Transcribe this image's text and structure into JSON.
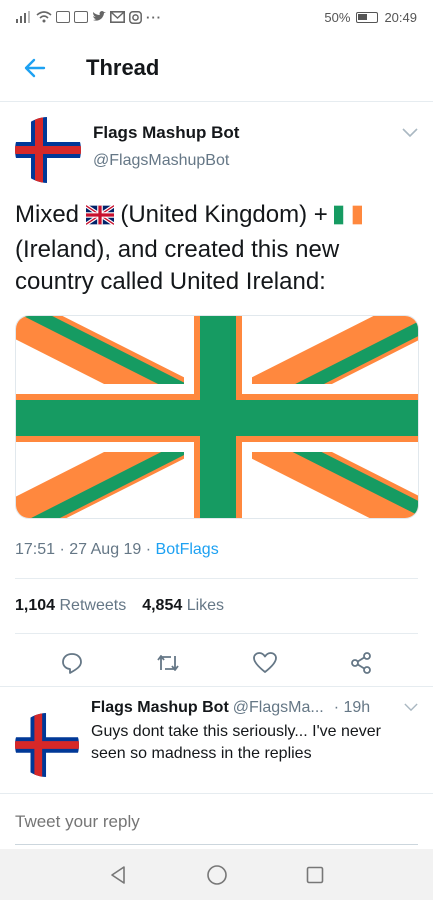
{
  "status_bar": {
    "battery_percent": "50%",
    "time": "20:49",
    "notification_icons": [
      "signal-icon",
      "wifi-icon",
      "facebook-icon",
      "photos-icon",
      "twitter-icon",
      "mail-icon",
      "instagram-icon",
      "more-icon"
    ],
    "more_glyph": "···"
  },
  "header": {
    "title": "Thread",
    "back_icon": "back-arrow-icon"
  },
  "tweet": {
    "author_name": "Flags Mashup Bot",
    "author_handle": "@FlagsMashupBot",
    "text_part1": "Mixed ",
    "text_part2": " (United Kingdom) + ",
    "text_part3": " (Ireland), and created this new country called United Ireland:",
    "timestamp": "17:51 · 27 Aug 19 · ",
    "source": "BotFlags",
    "retweets_count": "1,104",
    "retweets_label": "Retweets",
    "likes_count": "4,854",
    "likes_label": "Likes"
  },
  "reply": {
    "author_name": "Flags Mashup Bot",
    "author_handle": "@FlagsMa...",
    "time": "· 19h",
    "text": "Guys dont take this seriously... I've never seen so madness in the replies"
  },
  "compose": {
    "placeholder": "Tweet your reply"
  },
  "colors": {
    "accent": "#1da1f2",
    "flag_orange": "#ff883e",
    "flag_green": "#169b62",
    "faroe_blue": "#003897",
    "faroe_red": "#d72828"
  }
}
